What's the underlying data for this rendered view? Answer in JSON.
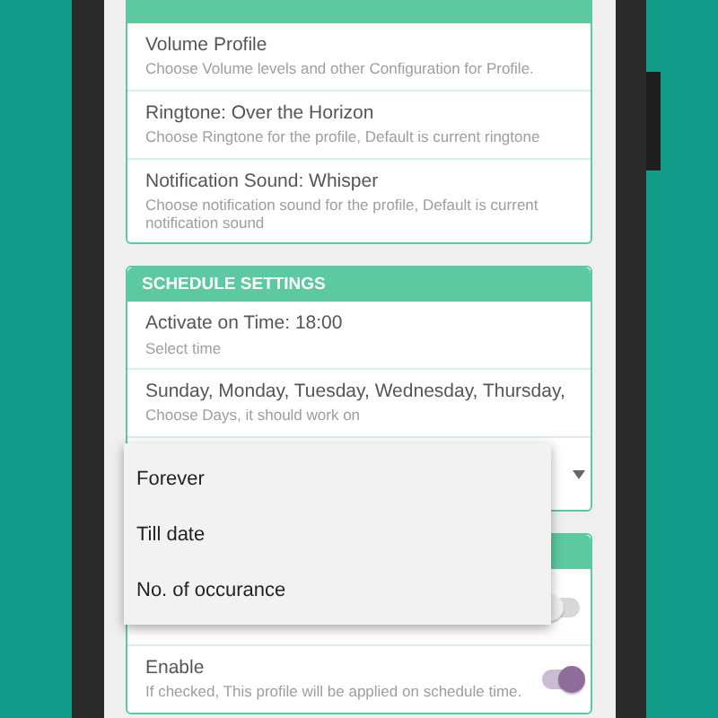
{
  "profile_card": {
    "items": [
      {
        "title": "Volume Profile",
        "subtitle": "Choose Volume levels and other Configuration for Profile."
      },
      {
        "title": "Ringtone: Over the Horizon",
        "subtitle": "Choose Ringtone for the profile, Default is current ringtone"
      },
      {
        "title": "Notification Sound: Whisper",
        "subtitle": "Choose notification sound for the profile, Default is current notification sound"
      }
    ]
  },
  "schedule_card": {
    "title": "SCHEDULE SETTINGS",
    "items": [
      {
        "kind": "setting",
        "title": "Activate on Time: 18:00",
        "subtitle": "Select time"
      },
      {
        "kind": "setting",
        "title": "Sunday, Monday, Tuesday, Wednesday, Thursday,",
        "subtitle": "Choose Days, it should work on"
      },
      {
        "kind": "dropdown"
      }
    ]
  },
  "options_card": {
    "items": [
      {
        "kind": "switch",
        "on": false
      },
      {
        "kind": "switch",
        "title": "Enable",
        "subtitle": "If checked, This profile will be applied on schedule time.",
        "on": true
      }
    ]
  },
  "dropdown_menu": {
    "options": [
      {
        "label": "Forever"
      },
      {
        "label": "Till date"
      },
      {
        "label": "No. of occurance"
      }
    ]
  }
}
